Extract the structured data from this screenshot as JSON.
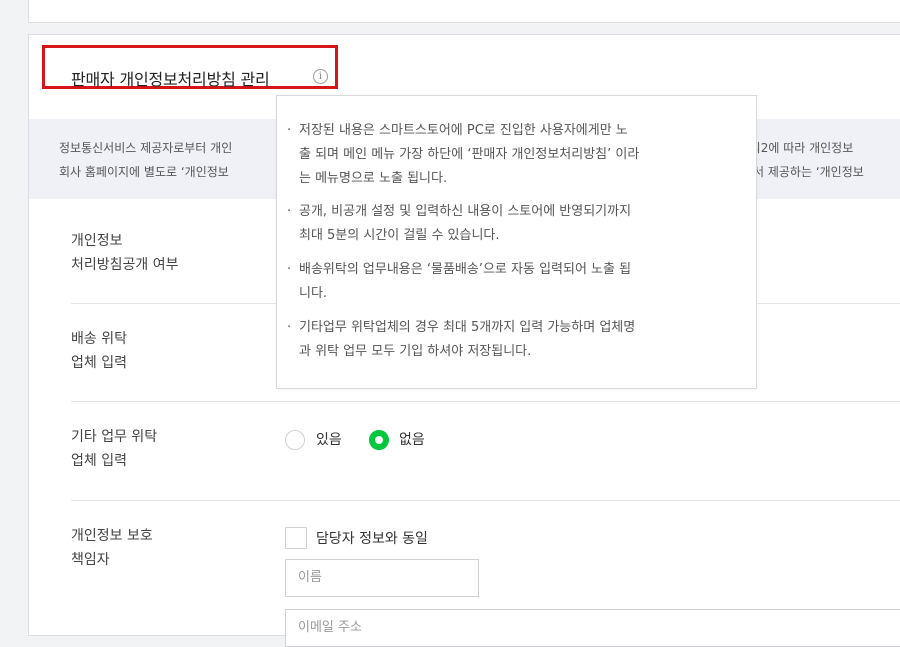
{
  "section": {
    "title": "판매자 개인정보처리방침 관리",
    "info_icon": "i"
  },
  "notice": {
    "line1_left": "정보통신서비스 제공자로부터 개인",
    "line1_right": "7조의2에 따라 개인정보",
    "line2_left": "회사 홈페이지에 별도로 ‘개인정보",
    "line2_right": "서 제공하는 ‘개인정보"
  },
  "rows": {
    "privacy_policy_public": {
      "label_l1": "개인정보",
      "label_l2": "처리방침공개 여부"
    },
    "delivery_consignment": {
      "label_l1": "배송 위탁",
      "label_l2": "업체 입력"
    },
    "other_consignment": {
      "label_l1": "기타 업무 위탁",
      "label_l2": "업체 입력",
      "options": [
        {
          "label": "있음",
          "selected": false
        },
        {
          "label": "없음",
          "selected": true
        }
      ]
    },
    "privacy_officer": {
      "label_l1": "개인정보 보호",
      "label_l2": "책임자",
      "same_as_manager_label": "담당자 정보와 동일",
      "name_placeholder": "이름",
      "email_placeholder": "이메일 주소"
    }
  },
  "tooltip": {
    "bullet": "·",
    "items": [
      {
        "l1": "저장된 내용은 스마트스토어에 PC로 진입한 사용자에게만 노",
        "l2": "출 되며 메인 메뉴 가장 하단에 ‘판매자 개인정보처리방침’ 이라",
        "l3": "는 메뉴명으로 노출 됩니다."
      },
      {
        "l1": "공개, 비공개 설정 및 입력하신 내용이 스토어에 반영되기까지",
        "l2": "최대 5분의 시간이 걸릴 수 있습니다."
      },
      {
        "l1": "배송위탁의 업무내용은 ‘물품배송’으로 자동 입력되어 노출 됩",
        "l2": "니다."
      },
      {
        "l1": "기타업무 위탁업체의 경우 최대 5개까지 입력 가능하며 업체명",
        "l2": "과 위탁 업무 모두 기입 하셔야 저장됩니다."
      }
    ]
  },
  "colors": {
    "accent_green": "#00c73c",
    "highlight_red": "#d8141b"
  }
}
